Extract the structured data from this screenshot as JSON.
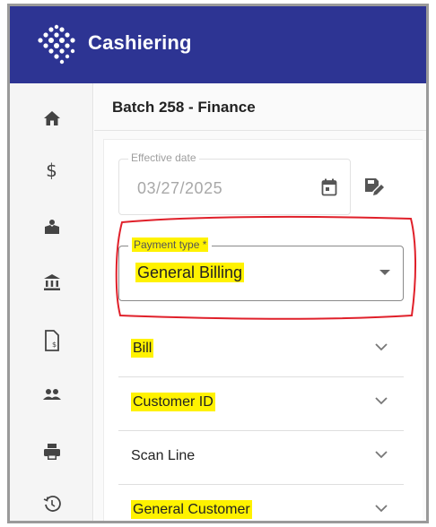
{
  "app": {
    "title": "Cashiering"
  },
  "sidebar": {
    "items": [
      {
        "name": "home",
        "icon": "home-icon"
      },
      {
        "name": "payments",
        "icon": "dollar-icon"
      },
      {
        "name": "hands",
        "icon": "hands-money-icon"
      },
      {
        "name": "bank",
        "icon": "bank-icon"
      },
      {
        "name": "document",
        "icon": "invoice-document-icon"
      },
      {
        "name": "customers",
        "icon": "people-icon"
      },
      {
        "name": "print",
        "icon": "printer-icon"
      },
      {
        "name": "history",
        "icon": "history-icon"
      }
    ]
  },
  "batch": {
    "title": "Batch 258 - Finance"
  },
  "effective_date": {
    "label": "Effective date",
    "value": "03/27/2025"
  },
  "payment_type": {
    "label": "Payment type *",
    "value": "General Billing"
  },
  "sections": [
    {
      "label": "Bill",
      "highlighted": true
    },
    {
      "label": "Customer ID",
      "highlighted": true
    },
    {
      "label": "Scan Line",
      "highlighted": false
    },
    {
      "label": "General Customer",
      "highlighted": true
    }
  ],
  "colors": {
    "appbar": "#2d3493",
    "highlight": "#fff200",
    "annotation": "#e0202a"
  }
}
